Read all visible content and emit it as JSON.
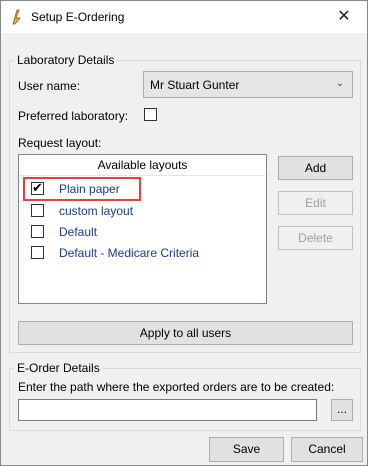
{
  "window": {
    "title": "Setup E-Ordering",
    "close_glyph": "✕"
  },
  "lab": {
    "legend": "Laboratory Details",
    "user_label": "User name:",
    "user_value": "Mr Stuart Gunter",
    "preferred_label": "Preferred laboratory:",
    "preferred_checked": false,
    "request_layout_label": "Request layout:",
    "list_header": "Available layouts",
    "layouts": [
      {
        "label": "Plain paper",
        "checked": true
      },
      {
        "label": "custom layout",
        "checked": false
      },
      {
        "label": "Default",
        "checked": false
      },
      {
        "label": "Default - Medicare Criteria",
        "checked": false
      }
    ],
    "add_label": "Add",
    "edit_label": "Edit",
    "delete_label": "Delete",
    "apply_label": "Apply to all users"
  },
  "eorder": {
    "legend": "E-Order Details",
    "path_label": "Enter the path where the exported orders are to be created:",
    "path_value": "",
    "browse_label": "..."
  },
  "footer": {
    "save_label": "Save",
    "cancel_label": "Cancel"
  },
  "colors": {
    "highlight": "#e0453d",
    "link_text": "#1a3a8c"
  }
}
